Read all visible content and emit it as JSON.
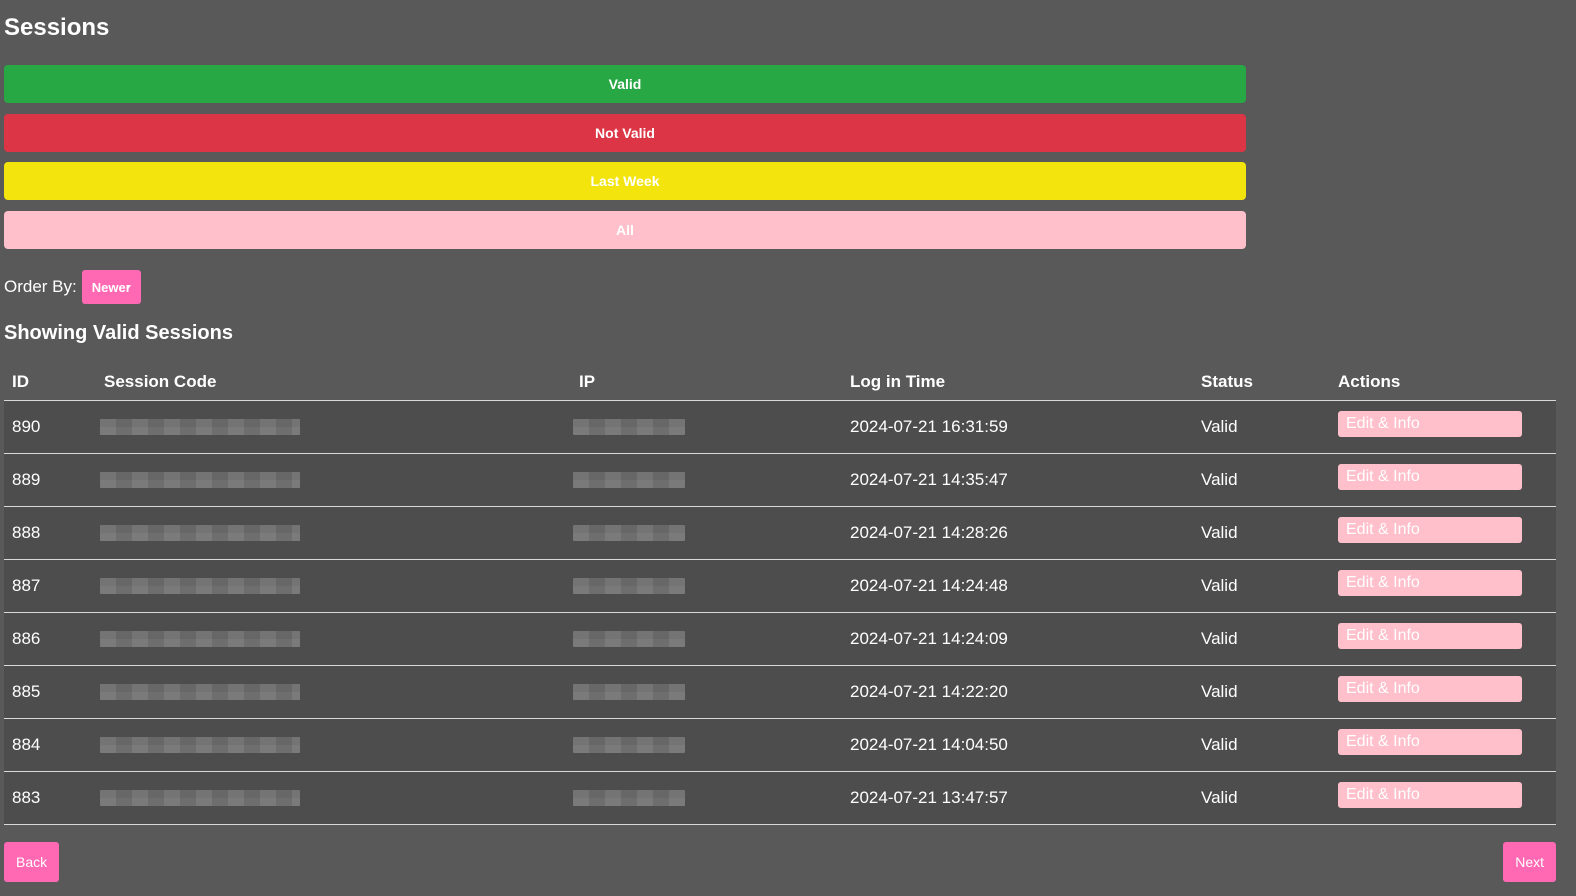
{
  "page_title": "Sessions",
  "filters": {
    "valid": {
      "label": "Valid",
      "color": "#28a745"
    },
    "not_valid": {
      "label": "Not Valid",
      "color": "#dc3545"
    },
    "last_week": {
      "label": "Last Week",
      "color": "#f2e40c"
    },
    "all": {
      "label": "All",
      "color": "#ffc0cb"
    }
  },
  "order_by": {
    "label": "Order By:",
    "selected": "Newer",
    "color": "#ff69b4"
  },
  "section_title": "Showing Valid Sessions",
  "table": {
    "headers": {
      "id": "ID",
      "session_code": "Session Code",
      "ip": "IP",
      "log_in_time": "Log in Time",
      "status": "Status",
      "actions": "Actions"
    },
    "action_label": "Edit & Info",
    "action_color": "#ffc0cb",
    "rows": [
      {
        "id": "890",
        "log_in_time": "2024-07-21 16:31:59",
        "status": "Valid"
      },
      {
        "id": "889",
        "log_in_time": "2024-07-21 14:35:47",
        "status": "Valid"
      },
      {
        "id": "888",
        "log_in_time": "2024-07-21 14:28:26",
        "status": "Valid"
      },
      {
        "id": "887",
        "log_in_time": "2024-07-21 14:24:48",
        "status": "Valid"
      },
      {
        "id": "886",
        "log_in_time": "2024-07-21 14:24:09",
        "status": "Valid"
      },
      {
        "id": "885",
        "log_in_time": "2024-07-21 14:22:20",
        "status": "Valid"
      },
      {
        "id": "884",
        "log_in_time": "2024-07-21 14:04:50",
        "status": "Valid"
      },
      {
        "id": "883",
        "log_in_time": "2024-07-21 13:47:57",
        "status": "Valid"
      }
    ]
  },
  "pagination": {
    "back_label": "Back",
    "next_label": "Next",
    "color": "#ff69b4"
  }
}
